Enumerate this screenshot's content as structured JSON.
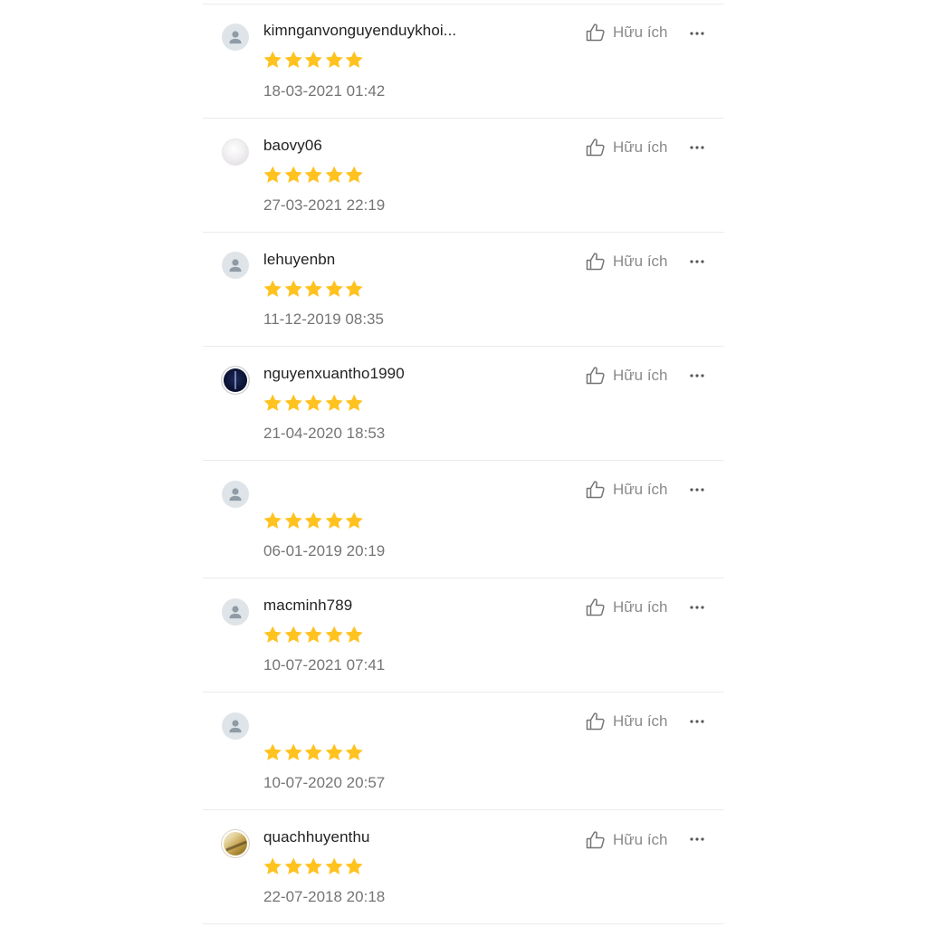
{
  "helpful_label": "Hữu ích",
  "star_color": "#FFC21F",
  "reviews": [
    {
      "username": "kimnganvonguyenduykhoi...",
      "avatar": "default-avatar",
      "rating": 5,
      "date": "18-03-2021 01:42"
    },
    {
      "username": "baovy06",
      "avatar": "light-photo-avatar",
      "rating": 5,
      "date": "27-03-2021 22:19"
    },
    {
      "username": "lehuyenbn",
      "avatar": "default-avatar",
      "rating": 5,
      "date": "11-12-2019 08:35"
    },
    {
      "username": "nguyenxuantho1990",
      "avatar": "dark-photo-avatar",
      "rating": 5,
      "date": "21-04-2020 18:53"
    },
    {
      "username": "",
      "avatar": "default-avatar",
      "rating": 5,
      "date": "06-01-2019 20:19"
    },
    {
      "username": "macminh789",
      "avatar": "default-avatar",
      "rating": 5,
      "date": "10-07-2021 07:41"
    },
    {
      "username": "",
      "avatar": "default-avatar",
      "rating": 5,
      "date": "10-07-2020 20:57"
    },
    {
      "username": "quachhuyenthu",
      "avatar": "gold-photo-avatar",
      "rating": 5,
      "date": "22-07-2018 20:18"
    }
  ]
}
